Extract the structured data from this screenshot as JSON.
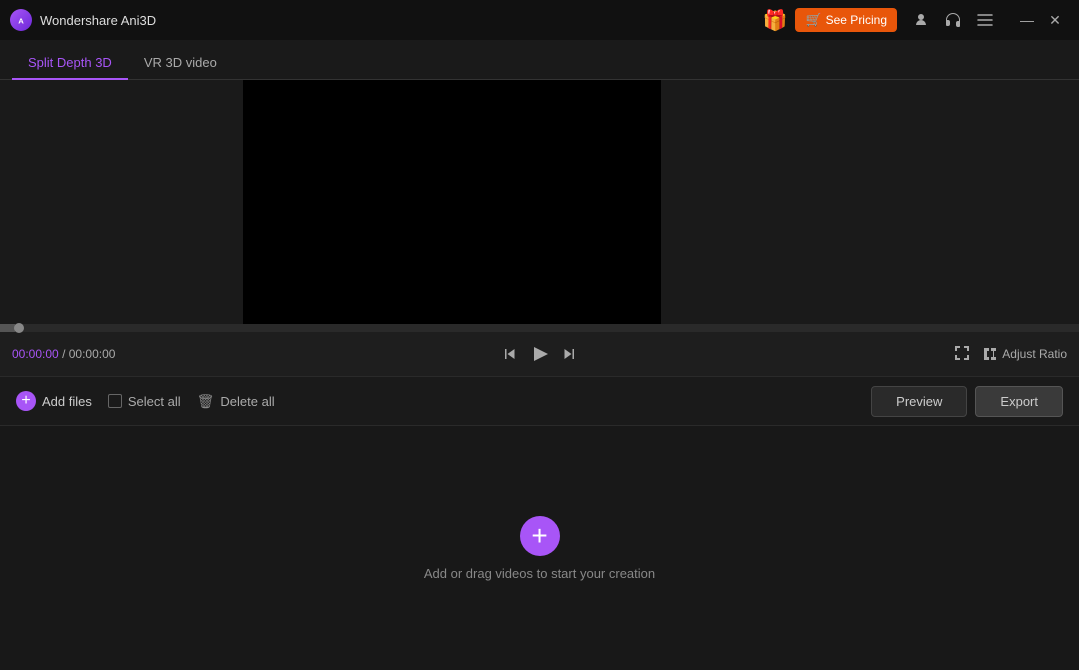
{
  "app": {
    "logo_label": "WS",
    "title": "Wondershare Ani3D"
  },
  "titlebar": {
    "gift_icon": "🎁",
    "see_pricing_label": "See Pricing",
    "menu_icon": "☰",
    "minimize_label": "—",
    "close_label": "✕"
  },
  "tabs": [
    {
      "id": "split-depth-3d",
      "label": "Split Depth 3D",
      "active": true
    },
    {
      "id": "vr-3d-video",
      "label": "VR 3D video",
      "active": false
    }
  ],
  "playback": {
    "time_current": "00:00:00",
    "time_separator": "/",
    "time_total": "00:00:00",
    "adjust_ratio_label": "Adjust Ratio"
  },
  "toolbar": {
    "add_files_label": "Add files",
    "select_all_label": "Select all",
    "delete_all_label": "Delete all",
    "preview_label": "Preview",
    "export_label": "Export"
  },
  "drop_area": {
    "message": "Add or drag videos to start your creation"
  }
}
